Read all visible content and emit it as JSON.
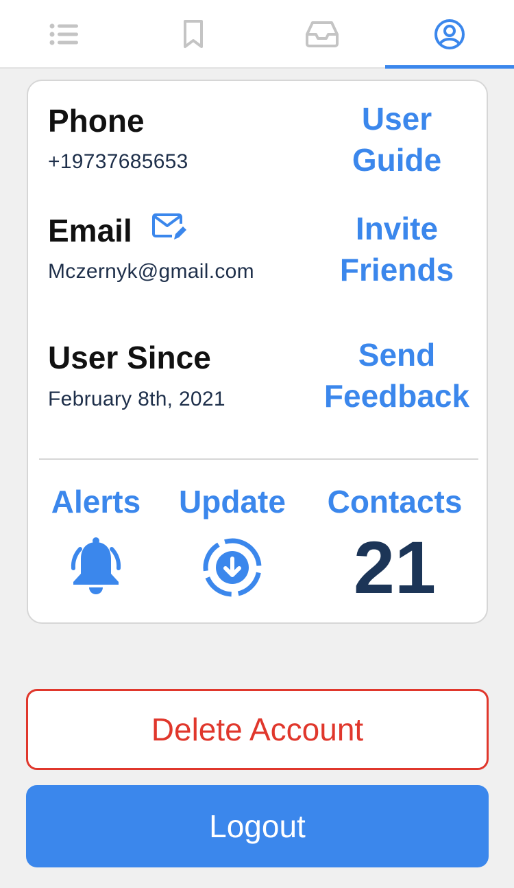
{
  "tabs": [
    {
      "icon": "list-icon"
    },
    {
      "icon": "bookmark-icon"
    },
    {
      "icon": "inbox-icon"
    },
    {
      "icon": "user-circle-icon",
      "active": true
    }
  ],
  "profile": {
    "phone_label": "Phone",
    "phone_value": "+19737685653",
    "email_label": "Email",
    "email_edit_icon": "email-edit-icon",
    "email_value": "Mczernyk@gmail.com",
    "since_label": "User Since",
    "since_value": "February 8th, 2021"
  },
  "links": {
    "user_guide": [
      "User",
      "Guide"
    ],
    "invite_friends": [
      "Invite",
      "Friends"
    ],
    "send_feedback": [
      "Send",
      "Feedback"
    ]
  },
  "stats": {
    "alerts_label": "Alerts",
    "alerts_icon": "bell-ringing-icon",
    "update_label": "Update",
    "update_icon": "download-circle-icon",
    "contacts_label": "Contacts",
    "contacts_count": "21"
  },
  "buttons": {
    "delete_label": "Delete Account",
    "logout_label": "Logout"
  },
  "colors": {
    "accent": "#3b87ec",
    "danger": "#e0372c",
    "inactive_icon": "#c4c4c4",
    "count": "#1c3557"
  }
}
